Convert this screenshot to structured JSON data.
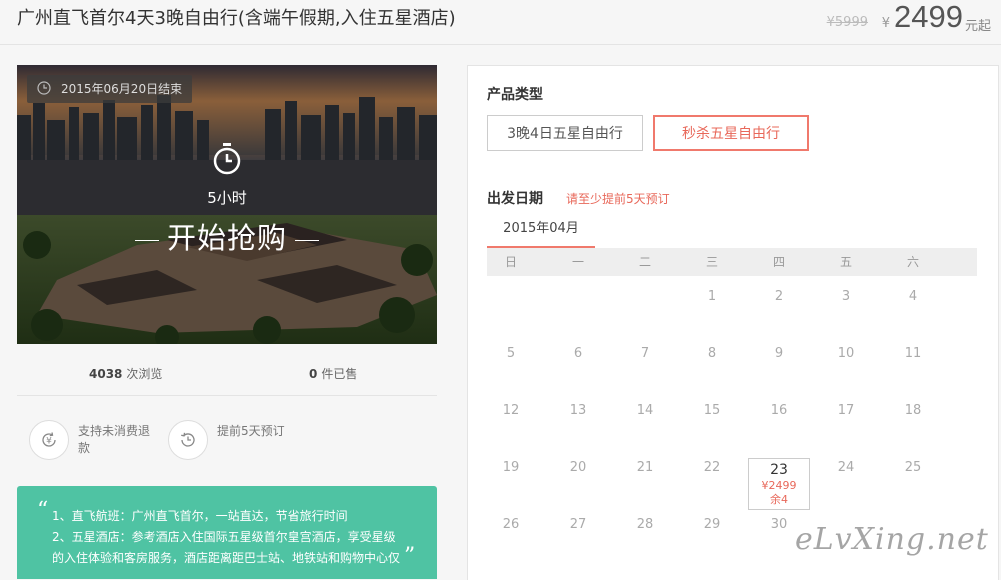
{
  "header": {
    "title": "广州直飞首尔4天3晚自由行(含端午假期,入住五星酒店)",
    "old_price": "¥5999",
    "currency": "¥",
    "price": "2499",
    "price_unit": "元起"
  },
  "hero": {
    "end_badge": "2015年06月20日结束",
    "hours": "5小时",
    "buy_label": "开始抢购"
  },
  "stats": {
    "views_num": "4038",
    "views_label": "次浏览",
    "sold_num": "0",
    "sold_label": "件已售"
  },
  "features": [
    {
      "icon": "yen-refund-icon",
      "text": "支持未消费退款"
    },
    {
      "icon": "history-icon",
      "text": "提前5天预订"
    }
  ],
  "notes": {
    "lines": [
      "1、直飞航班：广州直飞首尔，一站直达，节省旅行时间",
      "2、五星酒店：参考酒店入住国际五星级首尔皇宫酒店，享受星级",
      "的入住体验和客房服务，酒店距离距巴士站、地铁站和购物中心仅"
    ]
  },
  "panel": {
    "product_type_label": "产品类型",
    "types": [
      "3晚4日五星自由行",
      "秒杀五星自由行"
    ],
    "active_type": 1,
    "date_label": "出发日期",
    "advance_note": "请至少提前5天预订",
    "month": "2015年04月"
  },
  "calendar": {
    "weekdays": [
      "日",
      "一",
      "二",
      "三",
      "四",
      "五",
      "六"
    ],
    "first_weekday": 3,
    "days_shown": 30,
    "available": {
      "day": "23",
      "price": "¥2499",
      "remain": "余4"
    }
  },
  "colors": {
    "accent": "#f0796c",
    "notes_bg": "#4fc3a3"
  },
  "watermark": "eLvXing.net"
}
